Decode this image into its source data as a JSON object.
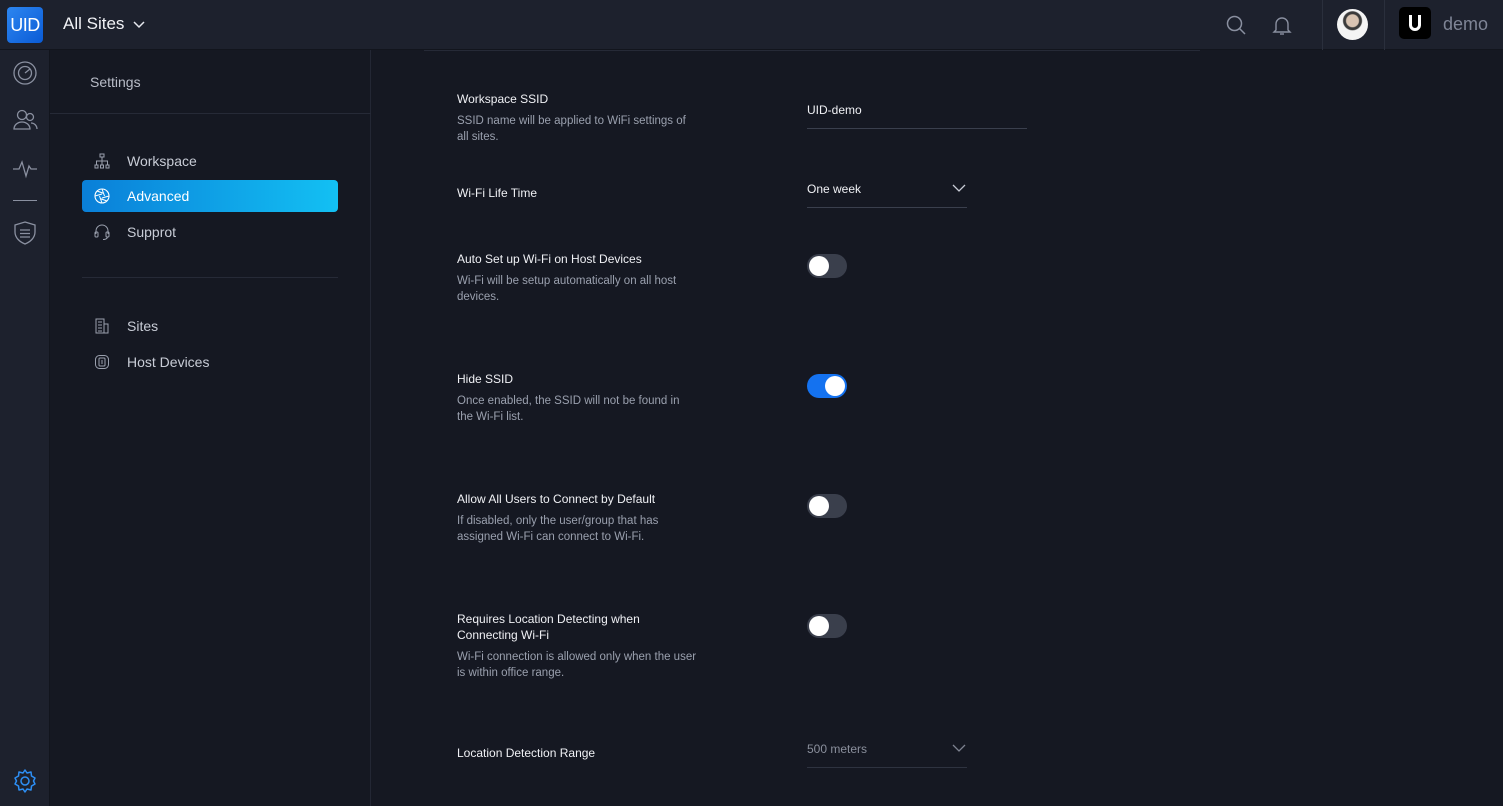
{
  "topbar": {
    "logo_text": "UID",
    "site_selector": "All Sites",
    "brand_name": "demo",
    "accent_color": "#1472f0"
  },
  "rail": {
    "icons": [
      "dashboard-icon",
      "users-icon",
      "activity-icon",
      "shield-list-icon",
      "settings-gear-icon"
    ]
  },
  "settings": {
    "title": "Settings",
    "nav_primary": [
      {
        "label": "Workspace",
        "icon": "network-tree-icon",
        "active": false
      },
      {
        "label": "Advanced",
        "icon": "aperture-icon",
        "active": true
      },
      {
        "label": "Supprot",
        "icon": "headset-icon",
        "active": false
      }
    ],
    "nav_secondary": [
      {
        "label": "Sites",
        "icon": "building-icon"
      },
      {
        "label": "Host Devices",
        "icon": "host-device-icon"
      }
    ]
  },
  "main": {
    "workspace_ssid": {
      "label": "Workspace SSID",
      "description": "SSID name will be applied to WiFi settings of all sites.",
      "value": "UID-demo"
    },
    "wifi_life_time": {
      "label": "Wi-Fi Life Time",
      "value": "One week"
    },
    "auto_setup": {
      "label": "Auto Set up Wi-Fi on Host Devices",
      "description": "Wi-Fi will be setup automatically on all host devices.",
      "enabled": false
    },
    "hide_ssid": {
      "label": "Hide SSID",
      "description": "Once enabled, the SSID will not be found in the Wi-Fi list.",
      "enabled": true
    },
    "allow_all_users": {
      "label": "Allow All Users to Connect by Default",
      "description": "If disabled, only the user/group that has assigned Wi-Fi can connect to Wi-Fi.",
      "enabled": false
    },
    "location_detecting": {
      "label": "Requires Location Detecting when Connecting Wi-Fi",
      "description": "Wi-Fi connection is allowed only when the user is within office range.",
      "enabled": false
    },
    "location_range": {
      "label": "Location Detection Range",
      "value": "500 meters"
    }
  }
}
